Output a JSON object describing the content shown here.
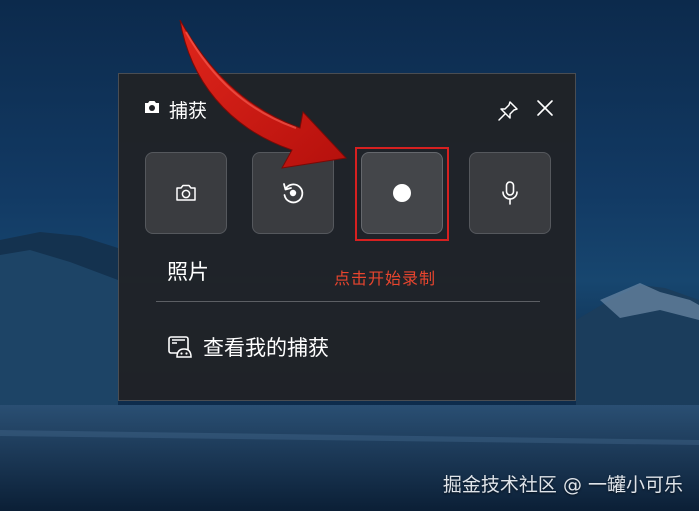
{
  "widget": {
    "title": "捕获",
    "mode_label": "照片",
    "annotation_hint": "点击开始录制",
    "gallery_link": "查看我的捕获",
    "tiles": [
      {
        "icon": "camera-icon"
      },
      {
        "icon": "replay-icon"
      },
      {
        "icon": "record-dot-icon"
      },
      {
        "icon": "microphone-icon"
      }
    ]
  },
  "watermark": "掘金技术社区 @ 一罐小可乐",
  "colors": {
    "panel_bg": "#202226",
    "tile_bg": "#3a3c40",
    "annotation_red": "#d62020",
    "hint_red": "#e8452e"
  }
}
